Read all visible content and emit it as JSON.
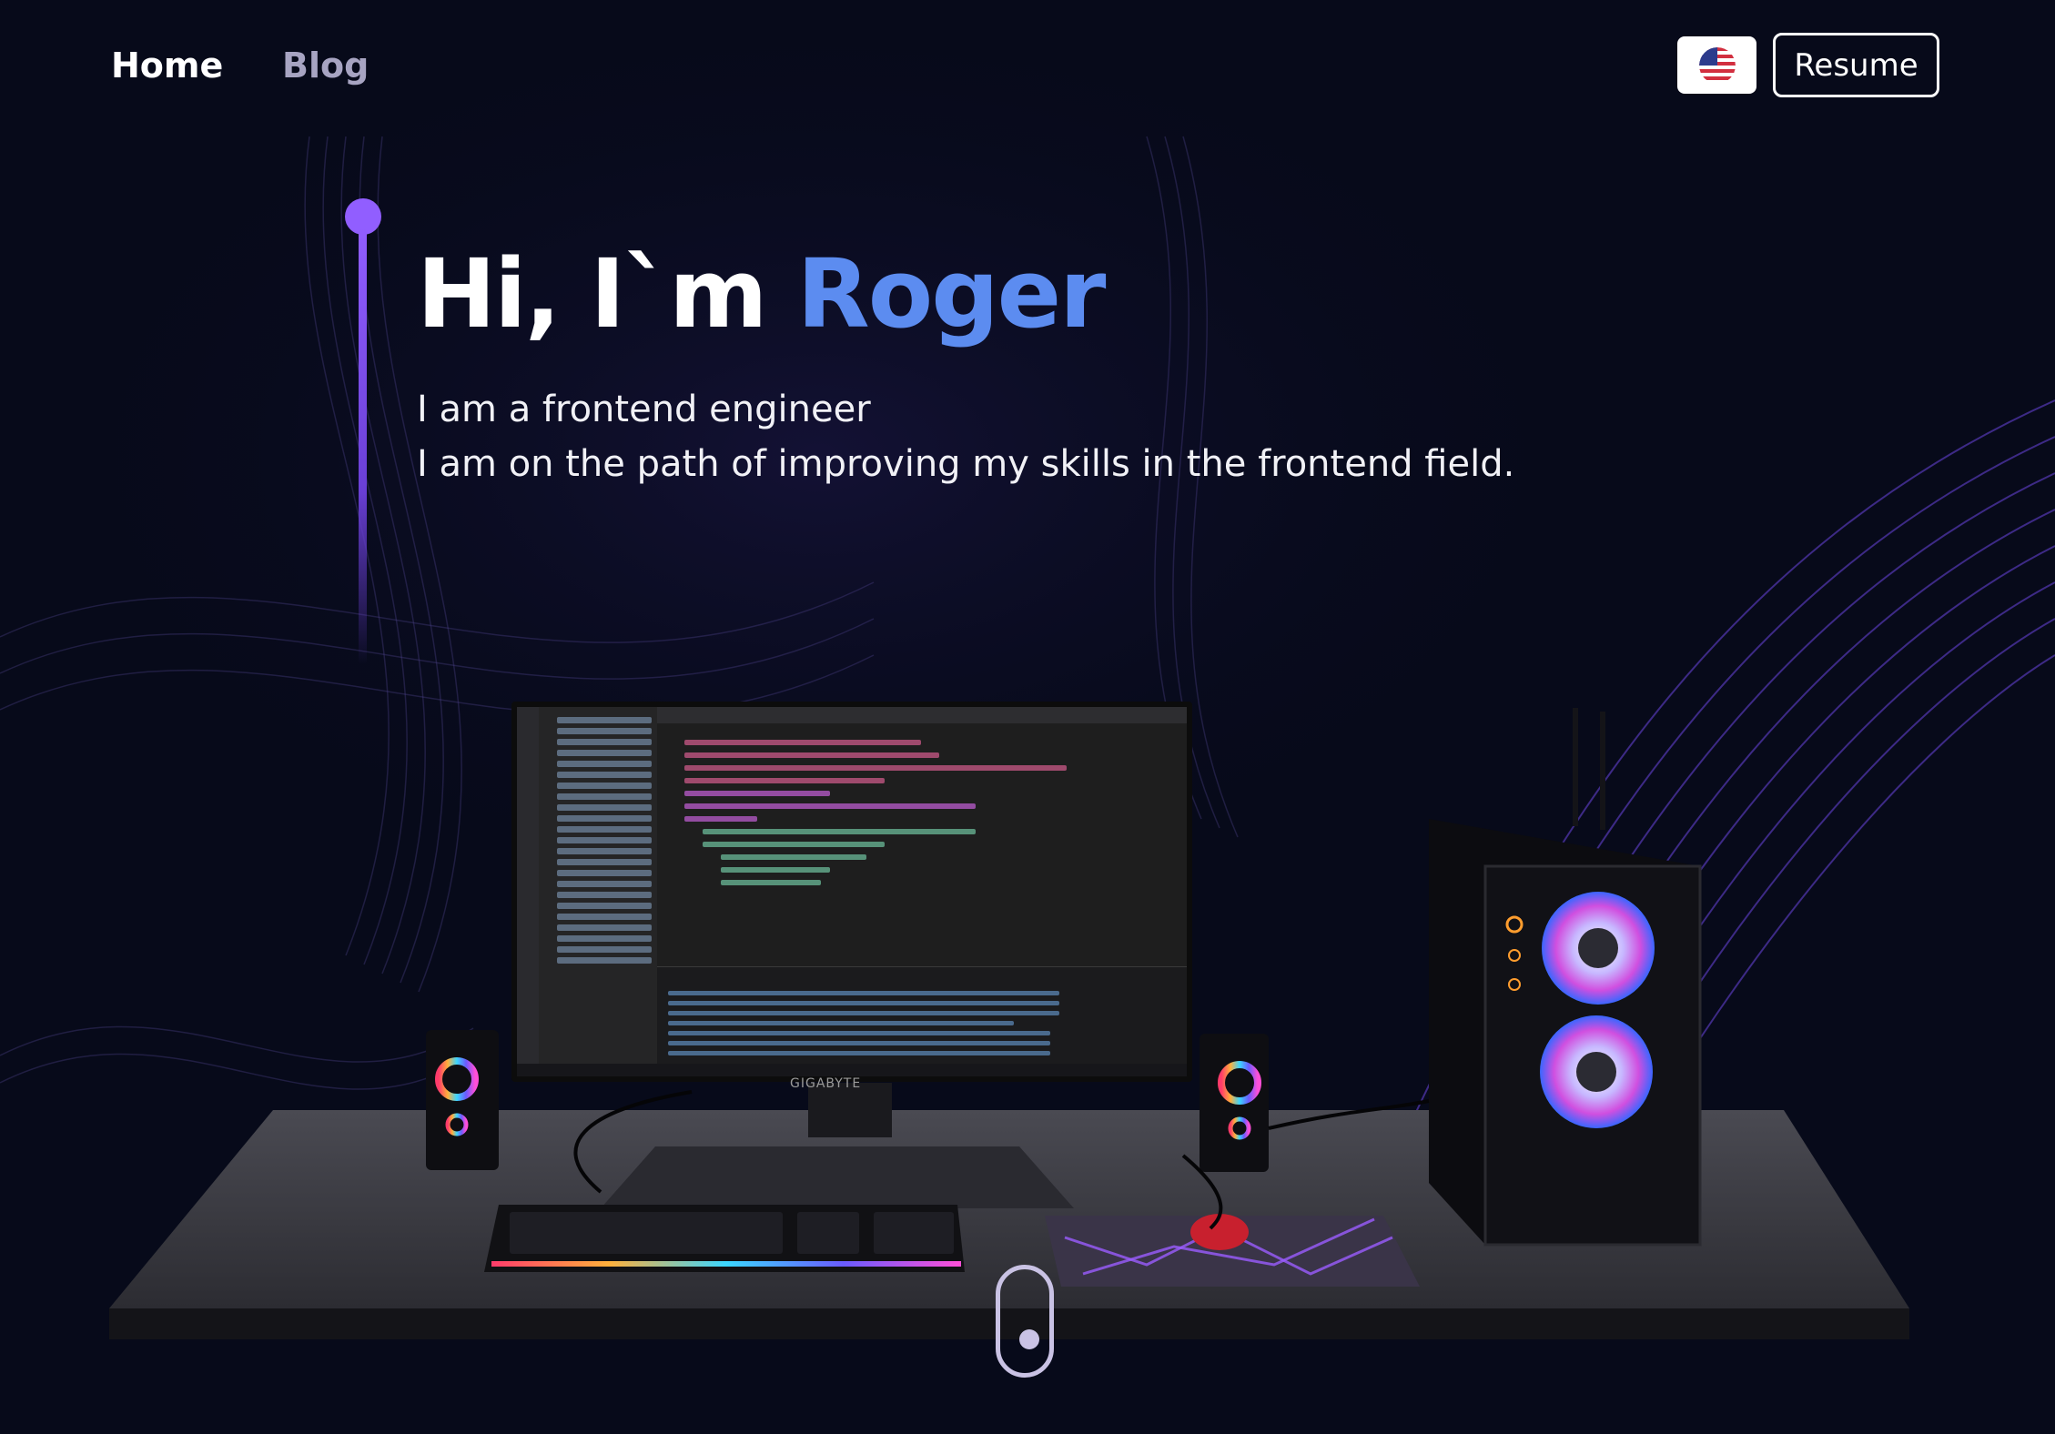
{
  "nav": {
    "home_label": "Home",
    "blog_label": "Blog",
    "resume_label": "Resume",
    "language_icon": "us-flag-icon"
  },
  "hero": {
    "greeting": "Hi, I`m ",
    "name": "Roger",
    "line1": "I am a frontend engineer",
    "line2": "I am on the path of improving my skills in the frontend field."
  },
  "scene": {
    "monitor_brand": "GIGABYTE"
  },
  "colors": {
    "background": "#070a1a",
    "accent": "#915eff",
    "name": "#5c8cf0",
    "nav_inactive": "#a7a4c2"
  }
}
